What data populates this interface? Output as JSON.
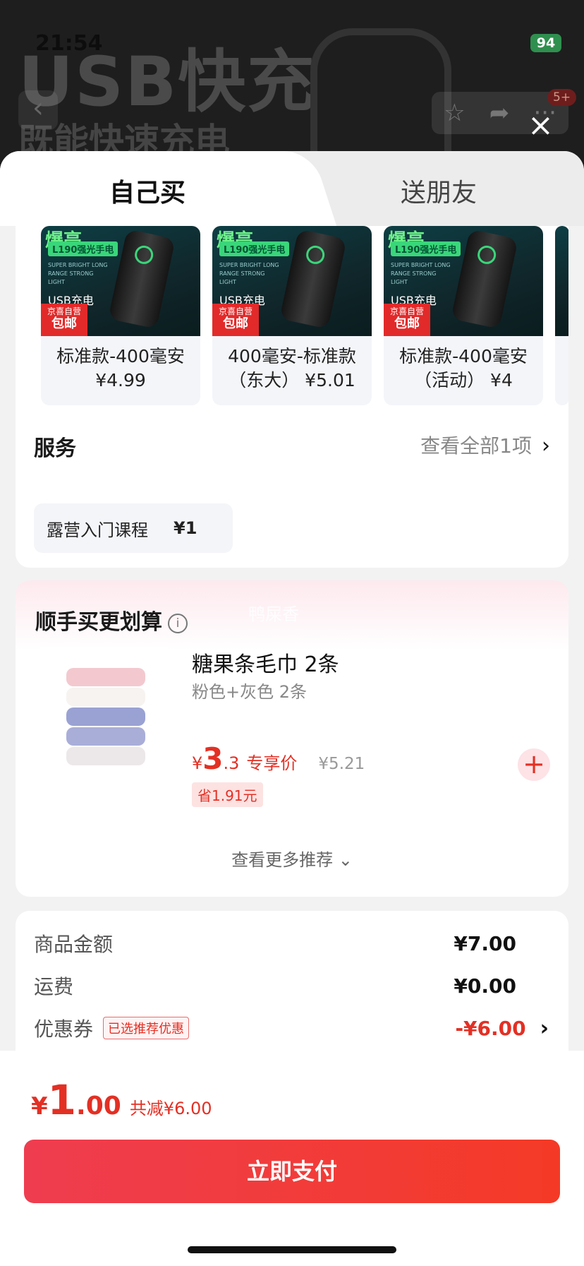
{
  "status": {
    "time": "21:54",
    "battery": "94"
  },
  "background": {
    "promo_line1": "USB快充",
    "promo_line2": "既能快速充电",
    "badge": "5+"
  },
  "tabs": [
    {
      "label": "自己买",
      "active": true
    },
    {
      "label": "送朋友",
      "active": false
    }
  ],
  "variants": [
    {
      "thumb_title": "爆亮",
      "thumb_tag": "L190强光手电",
      "thumb_small": "SUPER BRIGHT LONG RANGE STRONG LIGHT",
      "thumb_usb": "USB充电",
      "brand_top": "京喜自营",
      "brand_bottom": "包邮",
      "line1": "标准款-400毫安",
      "line2": "¥4.99"
    },
    {
      "thumb_title": "爆亮",
      "thumb_tag": "L190强光手电",
      "thumb_small": "SUPER BRIGHT LONG RANGE STRONG LIGHT",
      "thumb_usb": "USB充电",
      "brand_top": "京喜自营",
      "brand_bottom": "包邮",
      "line1": "400毫安-标准款",
      "line2": "（东大） ¥5.01"
    },
    {
      "thumb_title": "爆亮",
      "thumb_tag": "L190强光手电",
      "thumb_small": "SUPER BRIGHT LONG RANGE STRONG LIGHT",
      "thumb_usb": "USB充电",
      "brand_top": "京喜自营",
      "brand_bottom": "包邮",
      "line1": "标准款-400毫安",
      "line2": "（活动） ¥4"
    }
  ],
  "service": {
    "title": "服务",
    "view_all": "查看全部1项",
    "chip_name": "露营入门课程",
    "chip_price": "¥1"
  },
  "recommend": {
    "title": "顺手买更划算",
    "watermark": "鸭屎香",
    "product_name": "糖果条毛巾 2条",
    "product_spec": "粉色+灰色 2条",
    "price_yen": "¥",
    "price_int": "3",
    "price_dec": ".3",
    "exclusive_label": "专享价",
    "original_price": "¥5.21",
    "save_label": "省1.91元",
    "see_more": "查看更多推荐"
  },
  "summary": {
    "goods_label": "商品金额",
    "goods_value": "¥7.00",
    "shipping_label": "运费",
    "shipping_value": "¥0.00",
    "coupon_label": "优惠券",
    "coupon_tag": "已选推荐优惠",
    "coupon_value": "-¥6.00"
  },
  "checkout": {
    "total_yen": "¥",
    "total_int": "1",
    "total_dec": ".00",
    "discount_text": "共减¥6.00",
    "pay_label": "立即支付"
  },
  "colors": {
    "accent_red": "#e33024",
    "pay_gradient_start": "#ef3d50",
    "pay_gradient_end": "#f43a26"
  }
}
